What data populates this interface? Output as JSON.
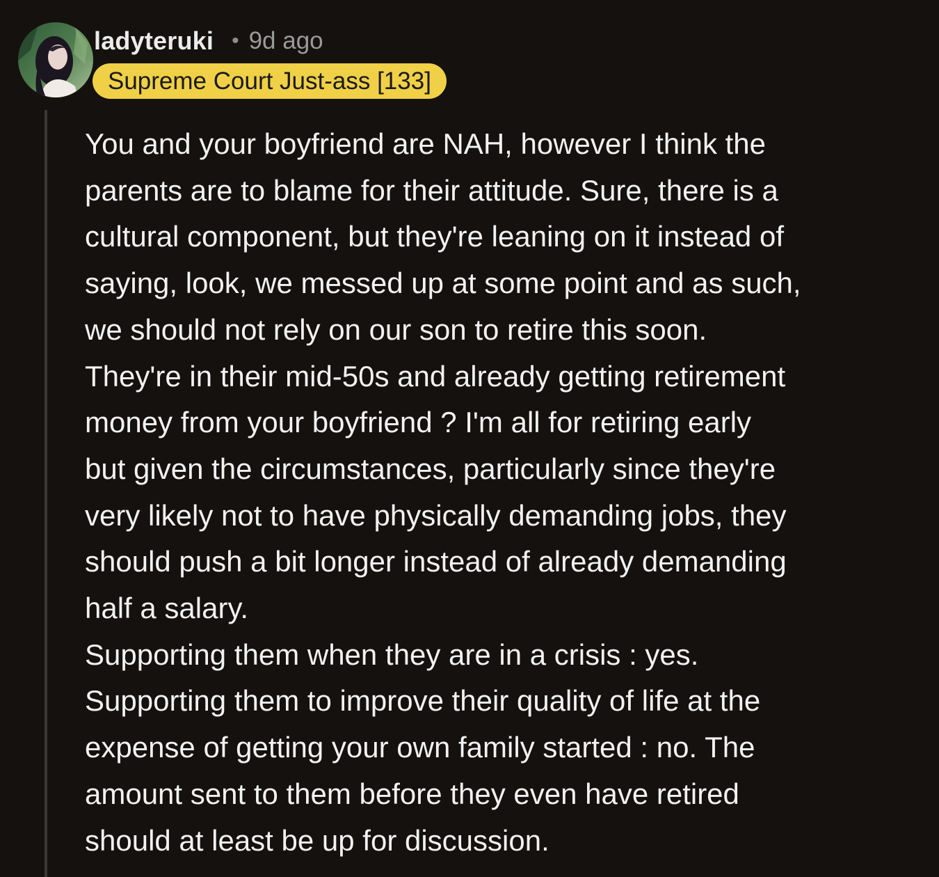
{
  "comment": {
    "author": "ladyteruki",
    "separator": "•",
    "age": "9d ago",
    "flair": "Supreme Court Just-ass [133]",
    "flair_color": "#f0d046",
    "avatar_icon": "user-avatar-photo",
    "body_lines": [
      "You and your boyfriend are NAH, however I think the",
      "parents are to blame for their attitude. Sure, there is a",
      "cultural component, but they're leaning on it instead of",
      "saying, look, we messed up at some point and as such,",
      "we should not rely on our son to retire this soon.",
      "They're in their mid-50s and already getting retirement",
      "money from your boyfriend ? I'm all for retiring early",
      "but given the circumstances, particularly since they're",
      "very likely not to have physically demanding jobs, they",
      "should push a bit longer instead of already demanding",
      "half a salary.",
      "Supporting them when they are in a crisis : yes.",
      "Supporting them to improve their quality of life at the",
      "expense of getting your own family started : no. The",
      "amount sent to them before they even have retired",
      "should at least be up for discussion."
    ]
  },
  "colors": {
    "background": "#15110e",
    "text": "#f2f2f2",
    "meta": "#9a9a9a",
    "thread_line": "#3a3735"
  }
}
